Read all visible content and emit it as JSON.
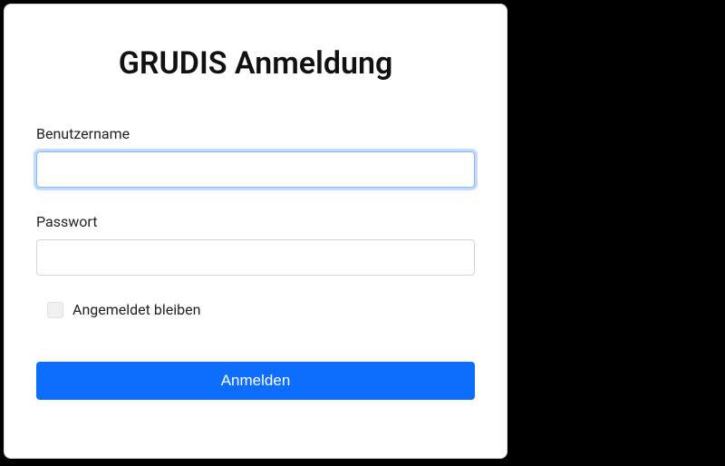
{
  "form": {
    "title": "GRUDIS Anmeldung",
    "username": {
      "label": "Benutzername",
      "value": ""
    },
    "password": {
      "label": "Passwort",
      "value": ""
    },
    "remember": {
      "label": "Angemeldet bleiben",
      "checked": false
    },
    "submit_label": "Anmelden"
  }
}
